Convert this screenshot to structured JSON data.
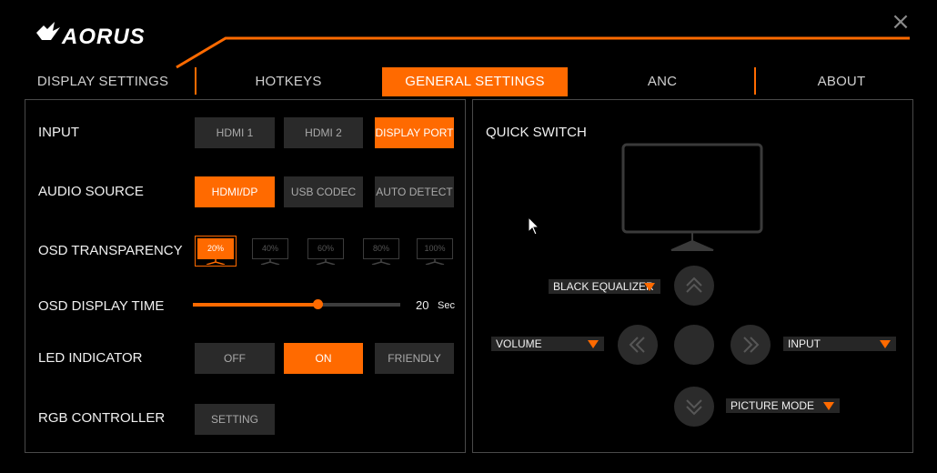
{
  "brand": {
    "logo_text": "AORUS"
  },
  "colors": {
    "accent": "#ff6a00",
    "background": "#000000",
    "button_idle": "#2a2a2a"
  },
  "window": {
    "close_icon": "×"
  },
  "tabs": [
    {
      "label": "DISPLAY SETTINGS",
      "active": false
    },
    {
      "label": "HOTKEYS",
      "active": false
    },
    {
      "label": "GENERAL SETTINGS",
      "active": true
    },
    {
      "label": "ANC",
      "active": false
    },
    {
      "label": "ABOUT",
      "active": false
    }
  ],
  "general": {
    "input": {
      "label": "INPUT",
      "options": [
        "HDMI 1",
        "HDMI 2",
        "DISPLAY PORT"
      ],
      "selected": "DISPLAY PORT"
    },
    "audio_source": {
      "label": "AUDIO SOURCE",
      "options": [
        "HDMI/DP",
        "USB CODEC",
        "AUTO DETECT"
      ],
      "selected": "HDMI/DP"
    },
    "osd_transparency": {
      "label": "OSD TRANSPARENCY",
      "options": [
        "20%",
        "40%",
        "60%",
        "80%",
        "100%"
      ],
      "selected": "20%"
    },
    "osd_display_time": {
      "label": "OSD DISPLAY TIME",
      "value": "20",
      "unit": "Sec",
      "level": 0.6
    },
    "led_indicator": {
      "label": "LED INDICATOR",
      "options": [
        "OFF",
        "ON",
        "FRIENDLY"
      ],
      "selected": "ON"
    },
    "rgb_controller": {
      "label": "RGB CONTROLLER",
      "button": "SETTING"
    }
  },
  "quick_switch": {
    "title": "QUICK SWITCH",
    "up_dropdown": "BLACK EQUALIZER",
    "left_dropdown": "VOLUME",
    "right_dropdown": "INPUT",
    "down_dropdown": "PICTURE MODE"
  }
}
